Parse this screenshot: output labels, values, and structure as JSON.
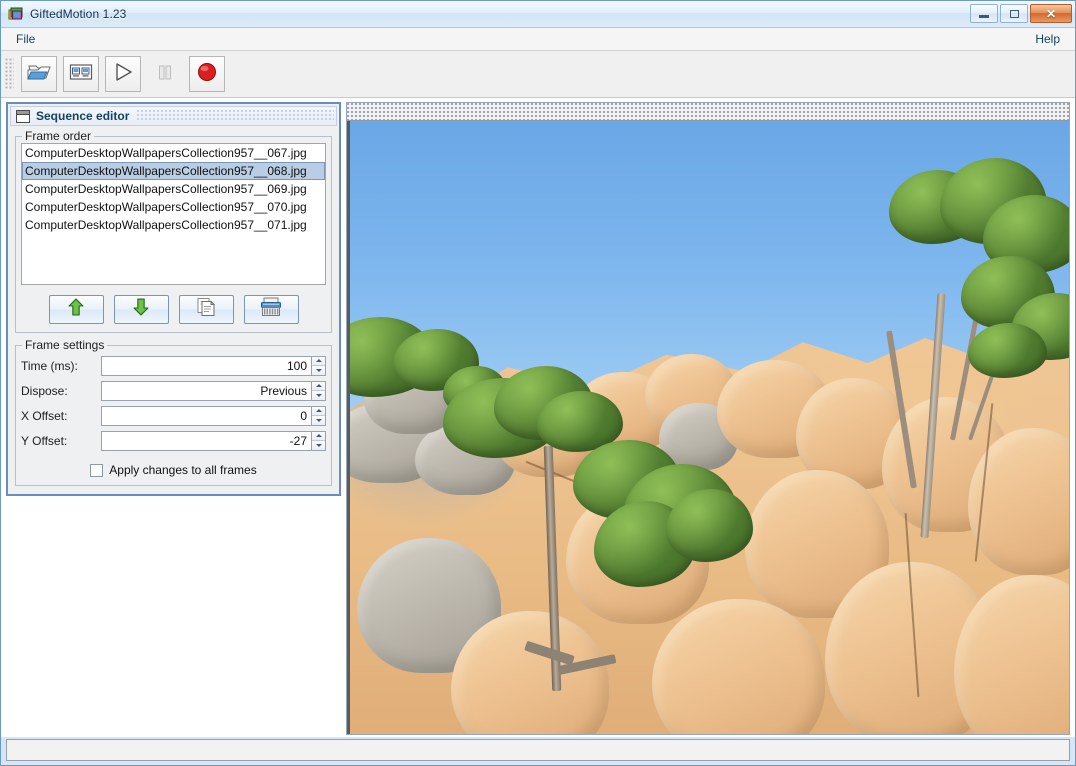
{
  "window": {
    "title": "GiftedMotion 1.23",
    "app_icon": "image-stack-icon",
    "buttons": {
      "minimize": "minimize-icon",
      "maximize": "maximize-icon",
      "close": "✕"
    }
  },
  "menubar": {
    "items": [
      {
        "label": "File",
        "name": "menu-file"
      }
    ],
    "right_items": [
      {
        "label": "Help",
        "name": "menu-help"
      }
    ]
  },
  "toolbar": {
    "buttons": [
      {
        "name": "open-files-button",
        "icon": "open-folder-icon",
        "enabled": true,
        "tooltip": "Open"
      },
      {
        "name": "save-as-button",
        "icon": "save-gif-icon",
        "enabled": true,
        "tooltip": "Save as GIF"
      },
      {
        "name": "play-button",
        "icon": "play-icon",
        "enabled": true,
        "tooltip": "Play"
      },
      {
        "name": "pause-button",
        "icon": "pause-icon",
        "enabled": false,
        "tooltip": "Pause"
      },
      {
        "name": "record-button",
        "icon": "record-icon",
        "enabled": true,
        "tooltip": "Record"
      }
    ]
  },
  "sequence_editor": {
    "title": "Sequence editor",
    "icon": "internal-window-icon",
    "frame_order": {
      "legend": "Frame order",
      "frames": [
        {
          "label": "ComputerDesktopWallpapersCollection957__067.jpg",
          "selected": false
        },
        {
          "label": "ComputerDesktopWallpapersCollection957__068.jpg",
          "selected": true
        },
        {
          "label": "ComputerDesktopWallpapersCollection957__069.jpg",
          "selected": false
        },
        {
          "label": "ComputerDesktopWallpapersCollection957__070.jpg",
          "selected": false
        },
        {
          "label": "ComputerDesktopWallpapersCollection957__071.jpg",
          "selected": false
        }
      ],
      "buttons": [
        {
          "name": "move-frame-up-button",
          "icon": "arrow-up-icon"
        },
        {
          "name": "move-frame-down-button",
          "icon": "arrow-down-icon"
        },
        {
          "name": "duplicate-frame-button",
          "icon": "copy-pages-icon"
        },
        {
          "name": "delete-frame-button",
          "icon": "shredder-icon"
        }
      ]
    },
    "frame_settings": {
      "legend": "Frame settings",
      "fields": [
        {
          "name": "time-ms",
          "label": "Time (ms):",
          "value": "100"
        },
        {
          "name": "dispose",
          "label": "Dispose:",
          "value": "Previous"
        },
        {
          "name": "x-offset",
          "label": "X Offset:",
          "value": "0"
        },
        {
          "name": "y-offset",
          "label": "Y Offset:",
          "value": "-27"
        }
      ],
      "apply_all": {
        "label": "Apply changes to all frames",
        "checked": false
      }
    }
  },
  "preview": {
    "name": "frame-preview",
    "alt": "Coastal landscape photo: granite boulders, juniper trees, blue sea and sky",
    "scrollbar": "horizontal-scrollbar-top"
  },
  "statusbar": {
    "text": ""
  },
  "colors": {
    "title_text": "#0b3050",
    "selection": "#b9cde4",
    "internal_frame_border": "#6a8cc0",
    "close_button": "#d5682f"
  }
}
